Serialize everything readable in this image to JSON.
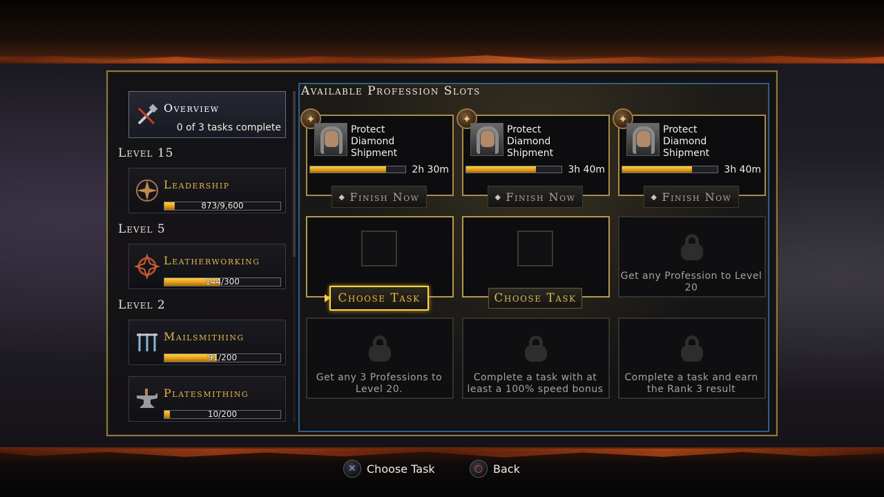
{
  "sidebar": {
    "overview": {
      "title": "Overview",
      "subtitle": "0 of 3 tasks complete",
      "icon": "crossed-tools-icon"
    },
    "levels": [
      {
        "label": "Level 15",
        "profession": "Leadership",
        "progress": "873/9,600",
        "fill": 0.09,
        "icon": "leadership-emblem-icon"
      },
      {
        "label": "Level 5",
        "profession": "Leatherworking",
        "progress": "144/300",
        "fill": 0.48,
        "icon": "leatherworking-emblem-icon"
      },
      {
        "label": "Level 2",
        "profession": "Mailsmithing",
        "progress": "91/200",
        "fill": 0.455,
        "icon": "mailsmithing-emblem-icon"
      },
      {
        "label": "",
        "profession": "Platesmithing",
        "progress": "10/200",
        "fill": 0.05,
        "icon": "anvil-icon"
      }
    ]
  },
  "panel": {
    "title": "Available Profession Slots",
    "active_slots": [
      {
        "task": "Protect Diamond Shipment",
        "time": "2h 30m",
        "fill": 0.8,
        "button": "Finish Now"
      },
      {
        "task": "Protect Diamond Shipment",
        "time": "3h 40m",
        "fill": 0.73,
        "button": "Finish Now"
      },
      {
        "task": "Protect Diamond Shipment",
        "time": "3h 40m",
        "fill": 0.73,
        "button": "Finish Now"
      }
    ],
    "empty_slots": [
      {
        "button": "Choose Task"
      },
      {
        "button": "Choose Task"
      }
    ],
    "locked_slots": [
      {
        "text": "Get any Profession to Level 20"
      },
      {
        "text": "Get any 3 Professions to Level 20."
      },
      {
        "text": "Complete a task with at least a 100% speed bonus"
      },
      {
        "text": "Complete a task and earn the Rank 3 result"
      }
    ]
  },
  "footer": {
    "primary": {
      "button": "cross",
      "label": "Choose Task"
    },
    "secondary": {
      "button": "circle",
      "label": "Back"
    }
  },
  "colors": {
    "gold": "#e3b84a",
    "panel_border": "#2f5f88",
    "frame_border": "#8f7a3e",
    "progress": "#e4a018"
  }
}
